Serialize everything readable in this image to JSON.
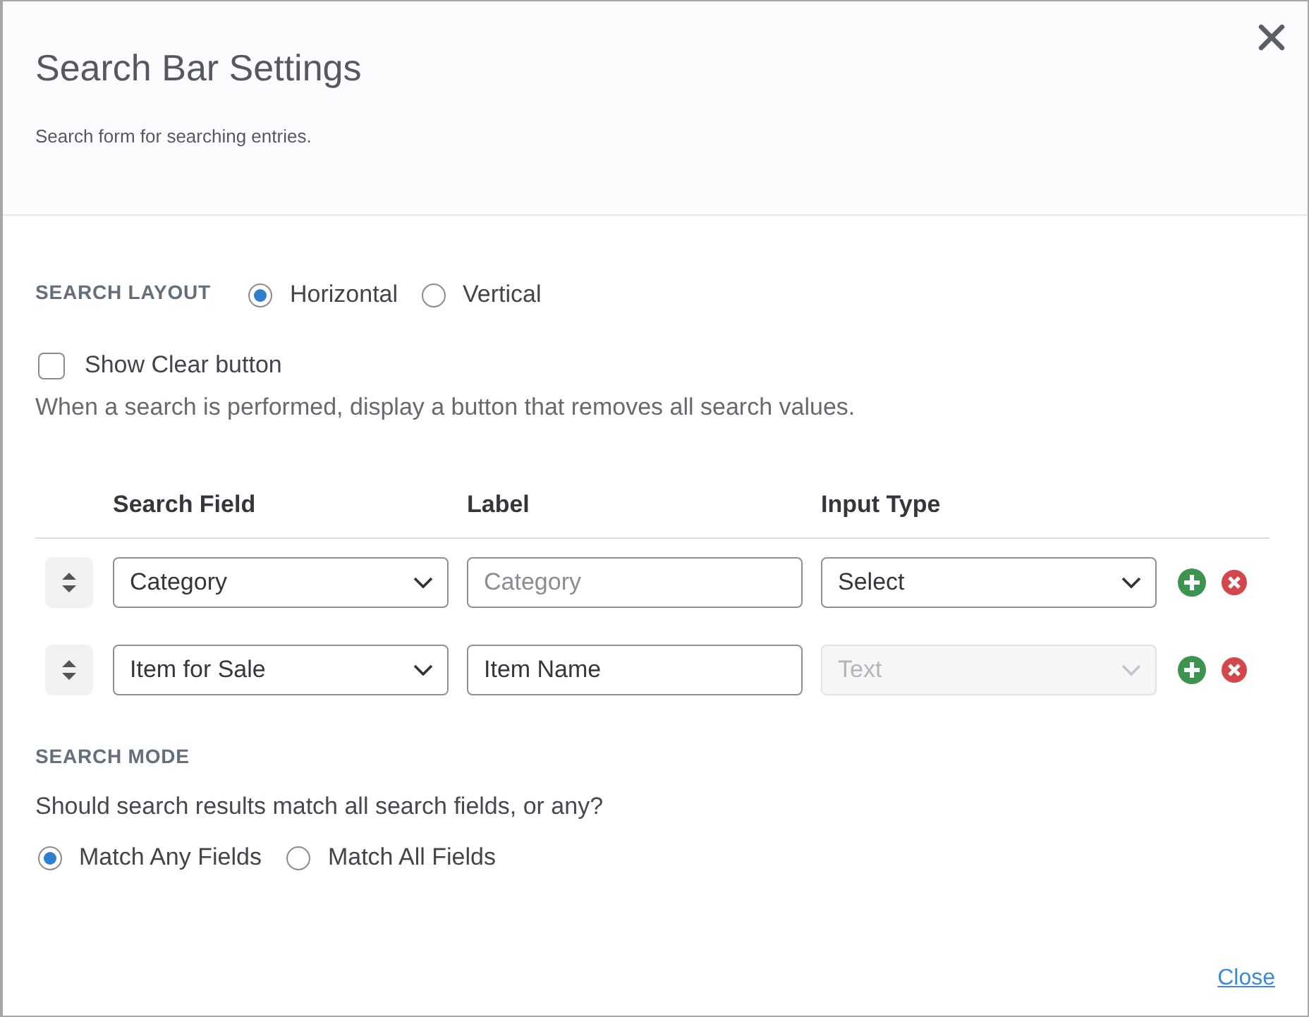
{
  "dialog": {
    "title": "Search Bar Settings",
    "subtitle": "Search form for searching entries."
  },
  "search_layout": {
    "label": "SEARCH LAYOUT",
    "options": [
      {
        "label": "Horizontal",
        "selected": true
      },
      {
        "label": "Vertical",
        "selected": false
      }
    ]
  },
  "show_clear_button": {
    "label": "Show Clear button",
    "checked": false,
    "help": "When a search is performed, display a button that removes all search values."
  },
  "search_fields": {
    "columns": [
      "Search Field",
      "Label",
      "Input Type"
    ],
    "rows": [
      {
        "search_field": "Category",
        "label": {
          "placeholder": "Category"
        },
        "input_type": {
          "value": "Select",
          "disabled": false
        }
      },
      {
        "search_field": "Item for Sale",
        "label": {
          "value": "Item Name"
        },
        "input_type": {
          "value": "Text",
          "disabled": true
        }
      }
    ]
  },
  "search_mode": {
    "label": "SEARCH MODE",
    "question": "Should search results match all search fields, or any?",
    "options": [
      {
        "label": "Match Any Fields",
        "selected": true
      },
      {
        "label": "Match All Fields",
        "selected": false
      }
    ]
  },
  "footer": {
    "close_link": "Close"
  }
}
